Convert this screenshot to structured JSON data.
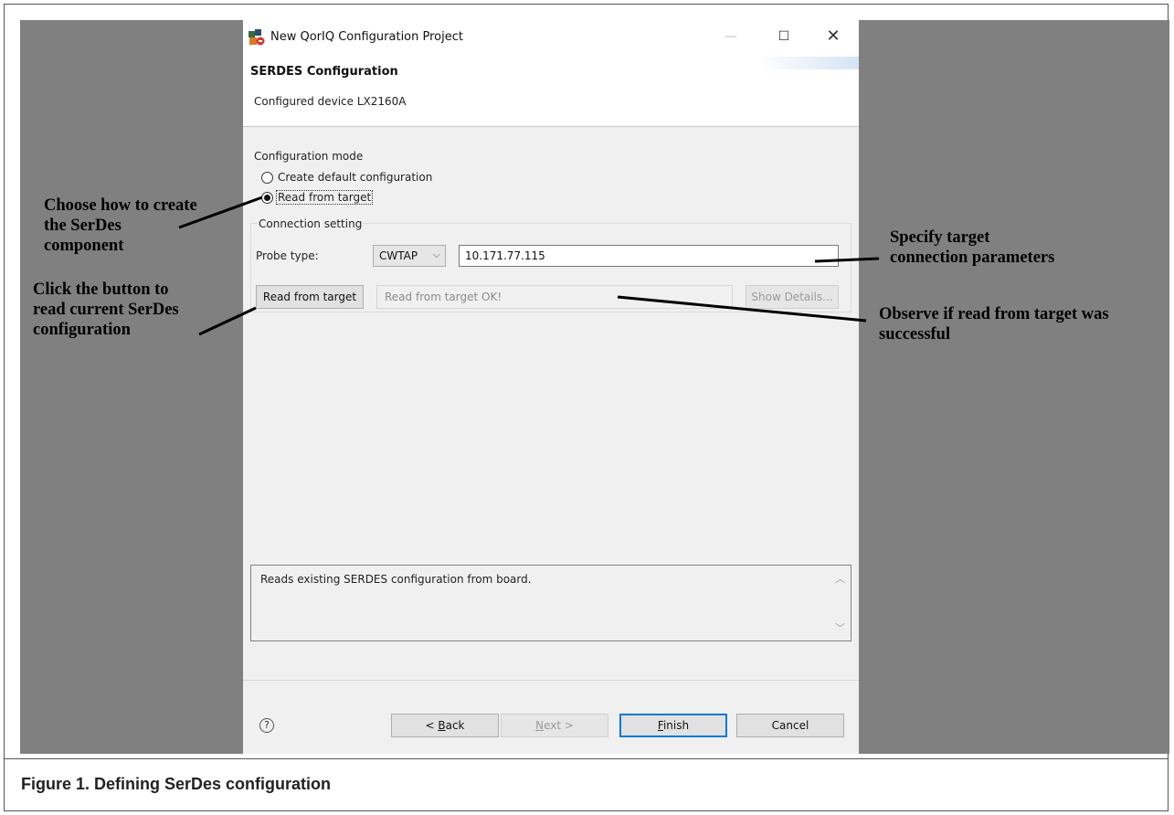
{
  "window": {
    "title": "New QorIQ Configuration Project",
    "icon": "app-icon",
    "min_glyph": "—",
    "max_glyph": "☐",
    "close_glyph": "✕"
  },
  "header": {
    "title": "SERDES Configuration",
    "subtitle": "Configured device LX2160A"
  },
  "config_mode": {
    "label": "Configuration mode",
    "options": [
      {
        "label": "Create default configuration",
        "selected": false
      },
      {
        "label": "Read from target",
        "selected": true
      }
    ]
  },
  "connection": {
    "group_label": "Connection setting",
    "probe_label": "Probe type:",
    "probe_value": "CWTAP",
    "address": "10.171.77.115",
    "read_button": "Read from target",
    "status": "Read from target OK!",
    "details_button": "Show Details..."
  },
  "description": "Reads existing SERDES configuration from board.",
  "footer": {
    "help": "?",
    "back": {
      "prefix": "< ",
      "mnemonic": "B",
      "rest": "ack"
    },
    "next": {
      "mnemonic": "N",
      "rest": "ext >"
    },
    "finish": {
      "mnemonic": "F",
      "rest": "inish"
    },
    "cancel": "Cancel"
  },
  "annotations": {
    "choose": [
      "Choose how to create",
      "the SerDes",
      "component"
    ],
    "click": [
      "Click the button to",
      "read current SerDes",
      "configuration"
    ],
    "specify": [
      "Specify target",
      "connection parameters"
    ],
    "observe": [
      "Observe if read from target was",
      "successful"
    ]
  },
  "caption": "Figure 1. Defining SerDes configuration"
}
